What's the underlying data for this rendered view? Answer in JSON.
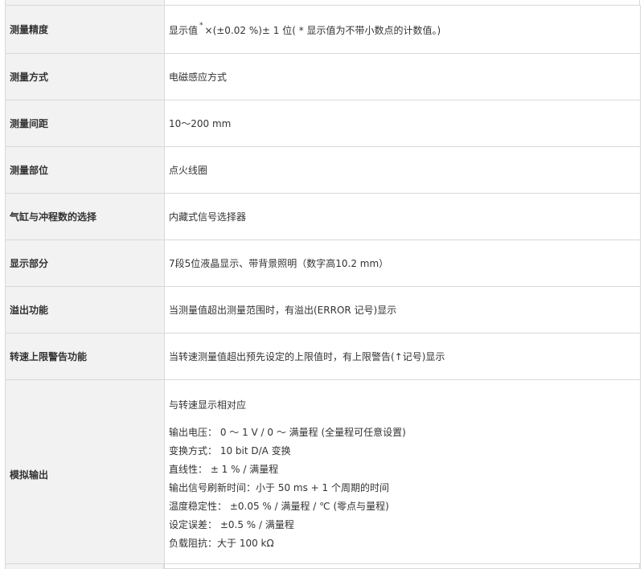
{
  "rows": [
    {
      "label": "测量精度",
      "value_prefix": "显示值",
      "value_mark": "*",
      "value_suffix": "×(±0.02 %)± 1 位( * 显示值为不带小数点的计数值。)"
    },
    {
      "label": "测量方式",
      "value": "电磁感应方式"
    },
    {
      "label": "测量间距",
      "value": "10～200 mm"
    },
    {
      "label": "测量部位",
      "value": "点火线圈"
    },
    {
      "label": "气缸与冲程数的选择",
      "value": "内藏式信号选择器"
    },
    {
      "label": "显示部分",
      "value": "7段5位液晶显示、带背景照明（数字高10.2 mm）"
    },
    {
      "label": "溢出功能",
      "value": "当测量值超出测量范围时，有溢出(ERROR 记号)显示"
    },
    {
      "label": "转速上限警告功能",
      "value": "当转速测量值超出预先设定的上限值时，有上限警告(↑记号)显示"
    }
  ],
  "analog": {
    "label": "模拟输出",
    "head": "与转速显示相对应",
    "lines": [
      "输出电压： 0 ～ 1 V / 0 ～ 满量程 (全量程可任意设置)",
      "变换方式： 10 bit D/A 变换",
      "直线性： ± 1 % / 满量程",
      "输出信号刷新时间：小于 50 ms + 1 个周期的时间",
      "温度稳定性： ±0.05 % / 满量程 / ℃ (零点与量程)",
      "设定误差： ±0.5 % / 满量程",
      "负载阻抗：大于 100 kΩ"
    ]
  }
}
